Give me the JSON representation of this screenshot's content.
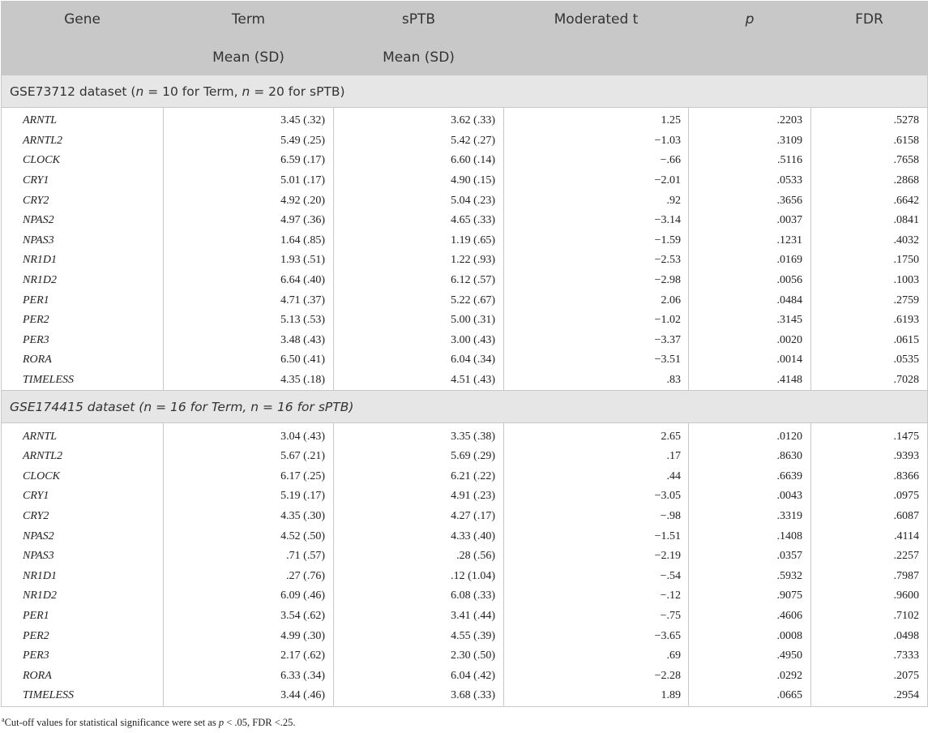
{
  "header": {
    "gene": "Gene",
    "term": "Term",
    "sptb": "sPTB",
    "moderated_t": "Moderated t",
    "p": "p",
    "fdr": "FDR",
    "mean_sd_term": "Mean (SD)",
    "mean_sd_sptb": "Mean (SD)"
  },
  "sections": [
    {
      "title_prefix": "GSE73712 dataset (",
      "title_n1": "n",
      "title_mid1": " = 10 for Term, ",
      "title_n2": "n",
      "title_mid2": " = 20 for sPTB)",
      "rows": [
        {
          "gene": "ARNTL",
          "term": "3.45 (.32)",
          "sptb": "3.62 (.33)",
          "t": "1.25",
          "p": ".2203",
          "fdr": ".5278"
        },
        {
          "gene": "ARNTL2",
          "term": "5.49 (.25)",
          "sptb": "5.42 (.27)",
          "t": "−1.03",
          "p": ".3109",
          "fdr": ".6158"
        },
        {
          "gene": "CLOCK",
          "term": "6.59 (.17)",
          "sptb": "6.60 (.14)",
          "t": "−.66",
          "p": ".5116",
          "fdr": ".7658"
        },
        {
          "gene": "CRY1",
          "term": "5.01 (.17)",
          "sptb": "4.90 (.15)",
          "t": "−2.01",
          "p": ".0533",
          "fdr": ".2868"
        },
        {
          "gene": "CRY2",
          "term": "4.92 (.20)",
          "sptb": "5.04 (.23)",
          "t": ".92",
          "p": ".3656",
          "fdr": ".6642"
        },
        {
          "gene": "NPAS2",
          "term": "4.97 (.36)",
          "sptb": "4.65 (.33)",
          "t": "−3.14",
          "p": ".0037",
          "fdr": ".0841"
        },
        {
          "gene": "NPAS3",
          "term": "1.64 (.85)",
          "sptb": "1.19 (.65)",
          "t": "−1.59",
          "p": ".1231",
          "fdr": ".4032"
        },
        {
          "gene": "NR1D1",
          "term": "1.93 (.51)",
          "sptb": "1.22 (.93)",
          "t": "−2.53",
          "p": ".0169",
          "fdr": ".1750"
        },
        {
          "gene": "NR1D2",
          "term": "6.64 (.40)",
          "sptb": "6.12 (.57)",
          "t": "−2.98",
          "p": ".0056",
          "fdr": ".1003"
        },
        {
          "gene": "PER1",
          "term": "4.71 (.37)",
          "sptb": "5.22 (.67)",
          "t": "2.06",
          "p": ".0484",
          "fdr": ".2759"
        },
        {
          "gene": "PER2",
          "term": "5.13 (.53)",
          "sptb": "5.00 (.31)",
          "t": "−1.02",
          "p": ".3145",
          "fdr": ".6193"
        },
        {
          "gene": "PER3",
          "term": "3.48 (.43)",
          "sptb": "3.00 (.43)",
          "t": "−3.37",
          "p": ".0020",
          "fdr": ".0615"
        },
        {
          "gene": "RORA",
          "term": "6.50 (.41)",
          "sptb": "6.04 (.34)",
          "t": "−3.51",
          "p": ".0014",
          "fdr": ".0535"
        },
        {
          "gene": "TIMELESS",
          "term": "4.35 (.18)",
          "sptb": "4.51 (.43)",
          "t": ".83",
          "p": ".4148",
          "fdr": ".7028"
        }
      ]
    },
    {
      "title_full": "GSE174415 dataset (n = 16 for Term, n = 16 for sPTB)",
      "rows": [
        {
          "gene": "ARNTL",
          "term": "3.04 (.43)",
          "sptb": "3.35 (.38)",
          "t": "2.65",
          "p": ".0120",
          "fdr": ".1475"
        },
        {
          "gene": "ARNTL2",
          "term": "5.67 (.21)",
          "sptb": "5.69 (.29)",
          "t": ".17",
          "p": ".8630",
          "fdr": ".9393"
        },
        {
          "gene": "CLOCK",
          "term": "6.17 (.25)",
          "sptb": "6.21 (.22)",
          "t": ".44",
          "p": ".6639",
          "fdr": ".8366"
        },
        {
          "gene": "CRY1",
          "term": "5.19 (.17)",
          "sptb": "4.91 (.23)",
          "t": "−3.05",
          "p": ".0043",
          "fdr": ".0975"
        },
        {
          "gene": "CRY2",
          "term": "4.35 (.30)",
          "sptb": "4.27 (.17)",
          "t": "−.98",
          "p": ".3319",
          "fdr": ".6087"
        },
        {
          "gene": "NPAS2",
          "term": "4.52 (.50)",
          "sptb": "4.33 (.40)",
          "t": "−1.51",
          "p": ".1408",
          "fdr": ".4114"
        },
        {
          "gene": "NPAS3",
          "term": ".71 (.57)",
          "sptb": ".28 (.56)",
          "t": "−2.19",
          "p": ".0357",
          "fdr": ".2257"
        },
        {
          "gene": "NR1D1",
          "term": ".27 (.76)",
          "sptb": ".12 (1.04)",
          "t": "−.54",
          "p": ".5932",
          "fdr": ".7987"
        },
        {
          "gene": "NR1D2",
          "term": "6.09 (.46)",
          "sptb": "6.08 (.33)",
          "t": "−.12",
          "p": ".9075",
          "fdr": ".9600"
        },
        {
          "gene": "PER1",
          "term": "3.54 (.62)",
          "sptb": "3.41 (.44)",
          "t": "−.75",
          "p": ".4606",
          "fdr": ".7102"
        },
        {
          "gene": "PER2",
          "term": "4.99 (.30)",
          "sptb": "4.55 (.39)",
          "t": "−3.65",
          "p": ".0008",
          "fdr": ".0498"
        },
        {
          "gene": "PER3",
          "term": "2.17 (.62)",
          "sptb": "2.30 (.50)",
          "t": ".69",
          "p": ".4950",
          "fdr": ".7333"
        },
        {
          "gene": "RORA",
          "term": "6.33 (.34)",
          "sptb": "6.04 (.42)",
          "t": "−2.28",
          "p": ".0292",
          "fdr": ".2075"
        },
        {
          "gene": "TIMELESS",
          "term": "3.44 (.46)",
          "sptb": "3.68 (.33)",
          "t": "1.89",
          "p": ".0665",
          "fdr": ".2954"
        }
      ]
    }
  ],
  "footnote": {
    "mark": "a",
    "prefix": "Cut-off values for statistical significance were set as ",
    "p": "p",
    "suffix": " < .05, FDR <.25."
  }
}
